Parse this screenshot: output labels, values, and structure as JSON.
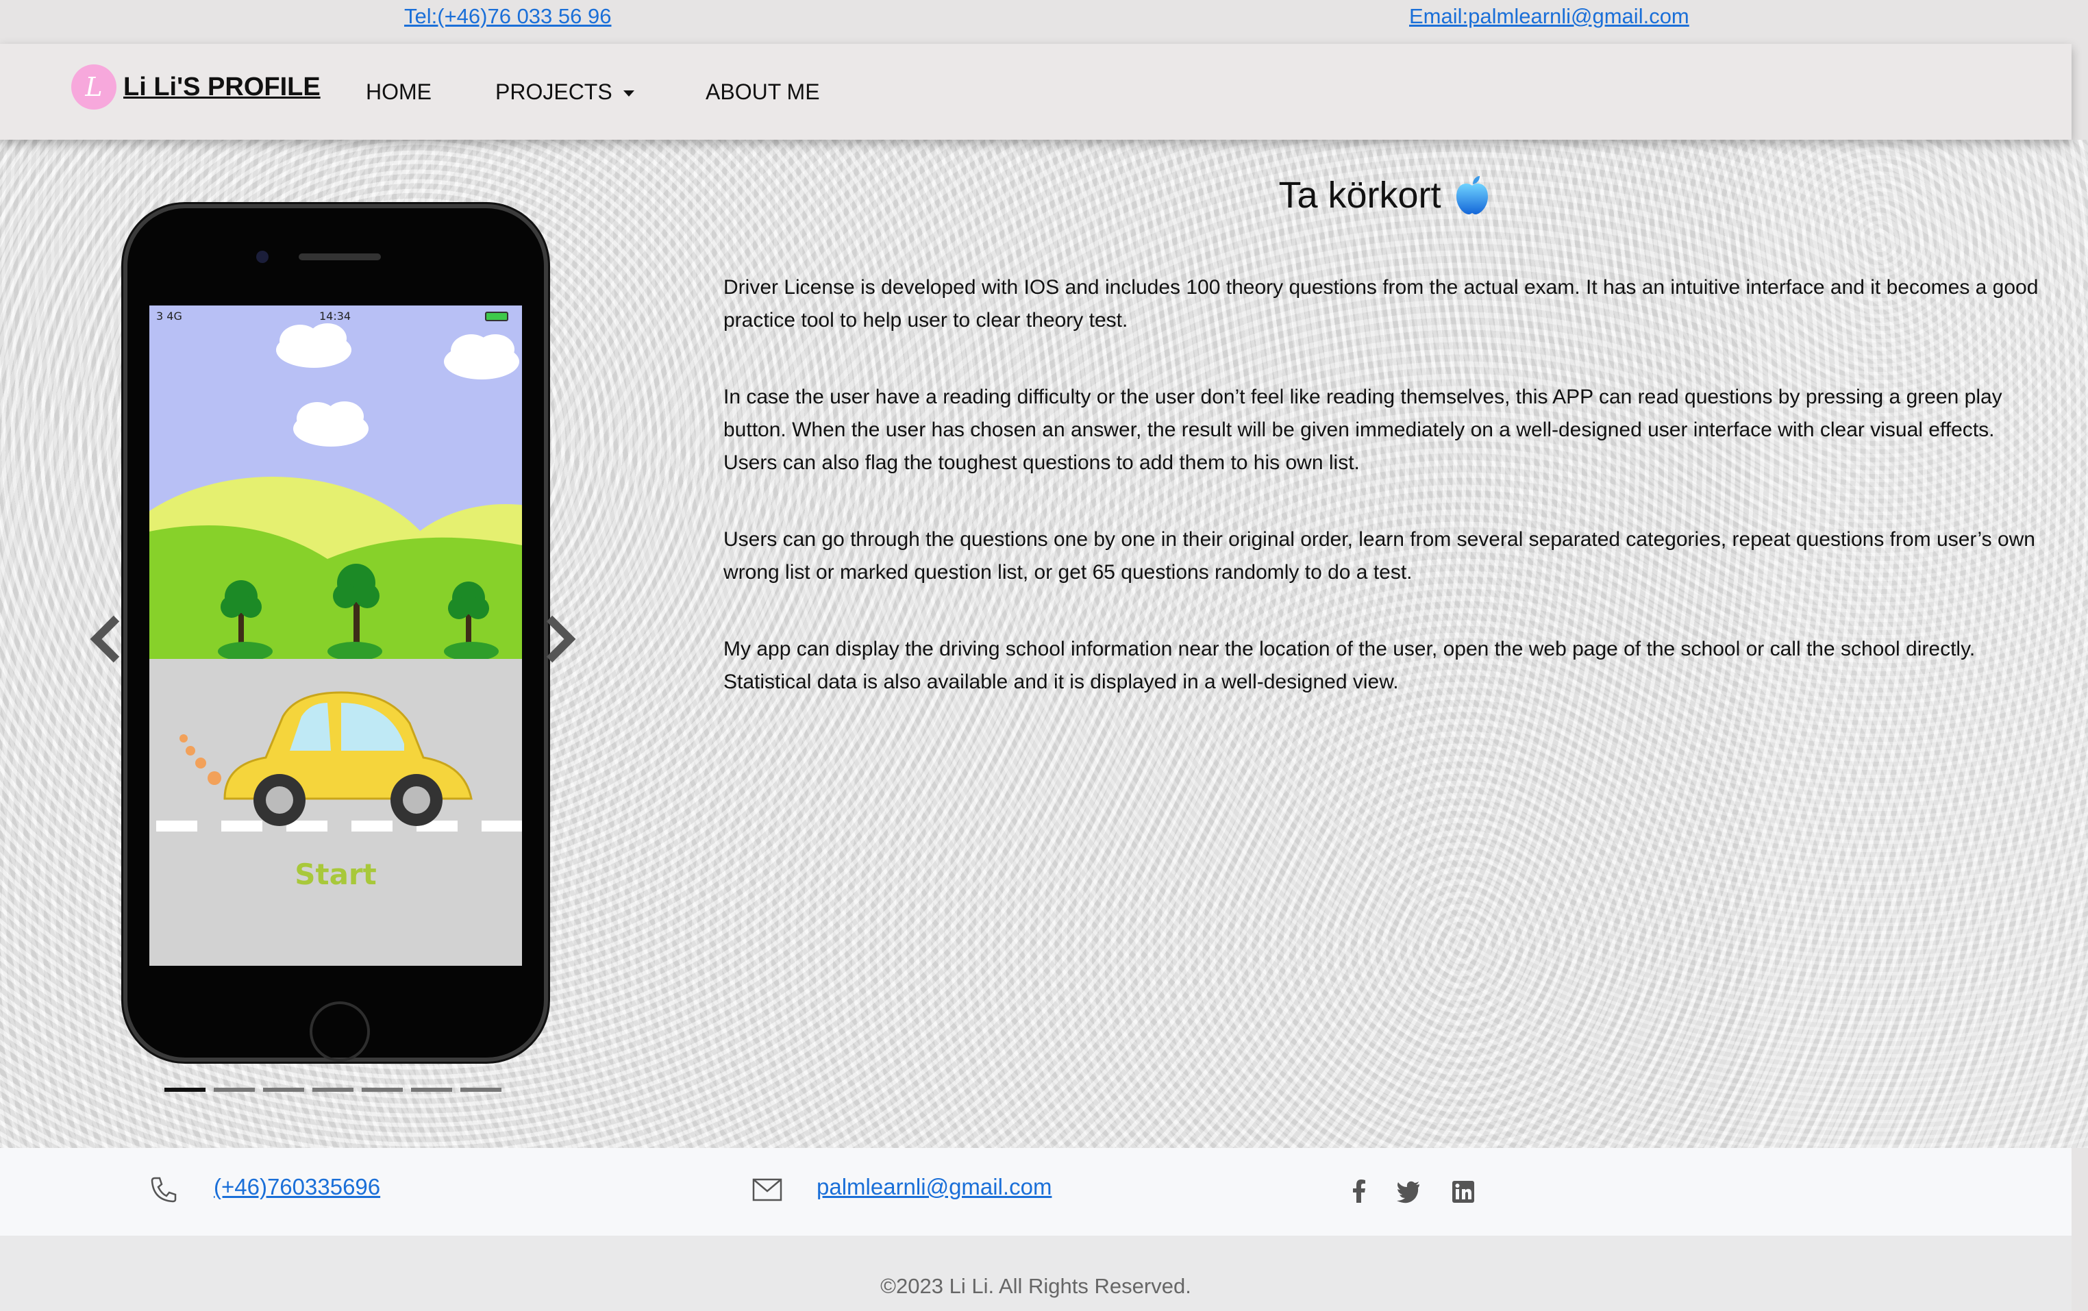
{
  "topbar": {
    "tel": "Tel:(+46)76 033 56 96",
    "email": "Email:palmlearnli@gmail.com"
  },
  "navbar": {
    "logo_letter": "L",
    "brand": "Li Li'S PROFILE",
    "items": [
      {
        "label": "HOME"
      },
      {
        "label": "PROJECTS"
      },
      {
        "label": "ABOUT ME"
      }
    ]
  },
  "carousel": {
    "phone_status_left": "3  4G",
    "phone_status_time": "14:34",
    "app_start_label": "Start",
    "slide_count": 7,
    "active_index": 0
  },
  "project": {
    "title": "Ta körkort",
    "title_icon": "apple-icon",
    "paragraphs": [
      "Driver License is developed with IOS and includes 100 theory questions from the actual exam. It has an intuitive interface and it becomes a good practice tool to help user to clear theory test.",
      "In case the user have a reading difficulty or the user don’t feel like reading themselves, this APP can read questions by pressing a green play button. When the user has chosen an answer, the result will be given immediately on a well-designed user interface with clear visual effects. Users can also flag the toughest questions to add them to his own list.",
      "Users can go through the questions one by one in their original order, learn from several separated categories, repeat questions from user’s own wrong list or marked question list, or get 65 questions randomly to do a test.",
      "My app can display the driving school information near the location of the user, open the web page of the school or call the school directly. Statistical data is also available and it is displayed in a well-designed view."
    ]
  },
  "footer": {
    "phone": "(+46)760335696",
    "email": "palmlearnli@gmail.com",
    "social": [
      "facebook-icon",
      "twitter-icon",
      "linkedin-icon"
    ],
    "copyright": "©2023 Li Li. All Rights Reserved."
  },
  "colors": {
    "link": "#1a6fd8",
    "logo_bg": "#f7a8dc",
    "navbar_bg": "#ebe8e8"
  }
}
